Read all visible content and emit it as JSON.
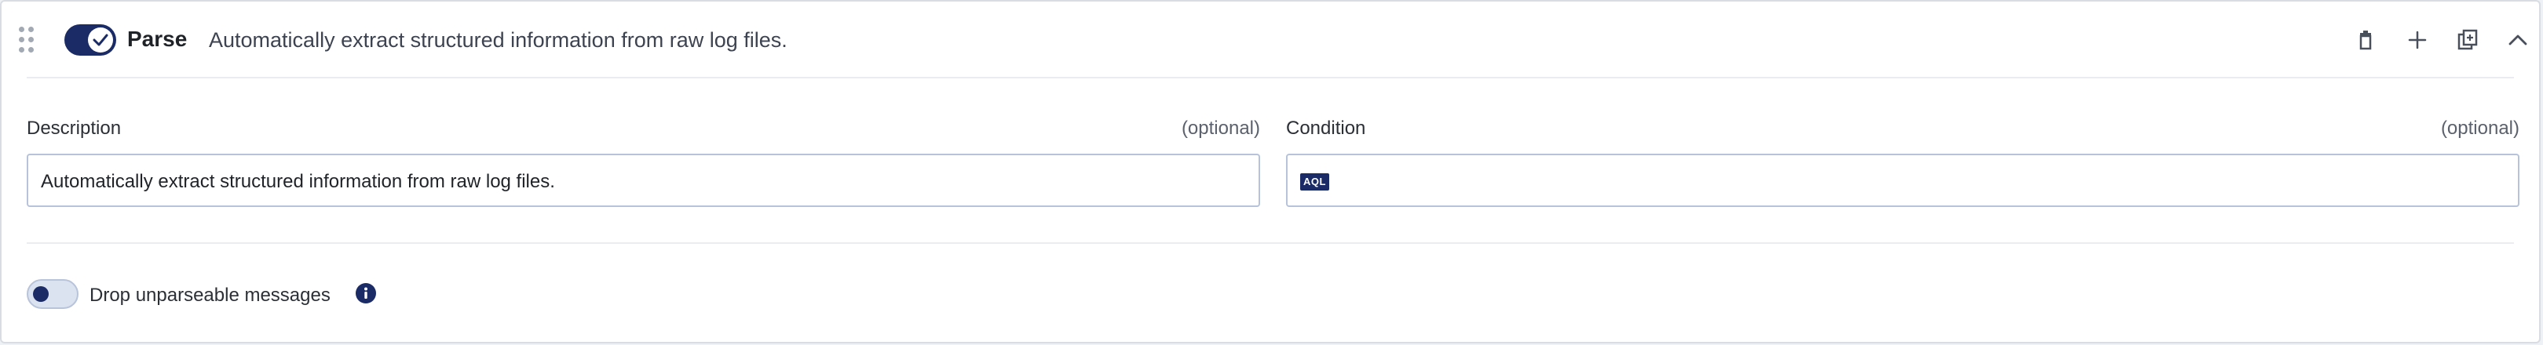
{
  "step": {
    "name": "Parse",
    "summary": "Automatically extract structured information from raw log files.",
    "enabled": true
  },
  "header_actions": {
    "delete_icon": "trash-icon",
    "add_icon": "plus-icon",
    "duplicate_icon": "duplicate-icon",
    "collapse_icon": "chevron-up-icon"
  },
  "description": {
    "label": "Description",
    "optional": "(optional)",
    "value": "Automatically extract structured information from raw log files."
  },
  "condition": {
    "label": "Condition",
    "optional": "(optional)",
    "badge": "AQL",
    "value": ""
  },
  "drop_unparseable": {
    "label": "Drop unparseable messages",
    "enabled": false
  },
  "colors": {
    "accent": "#1a2b66",
    "border": "#b6c3da"
  }
}
